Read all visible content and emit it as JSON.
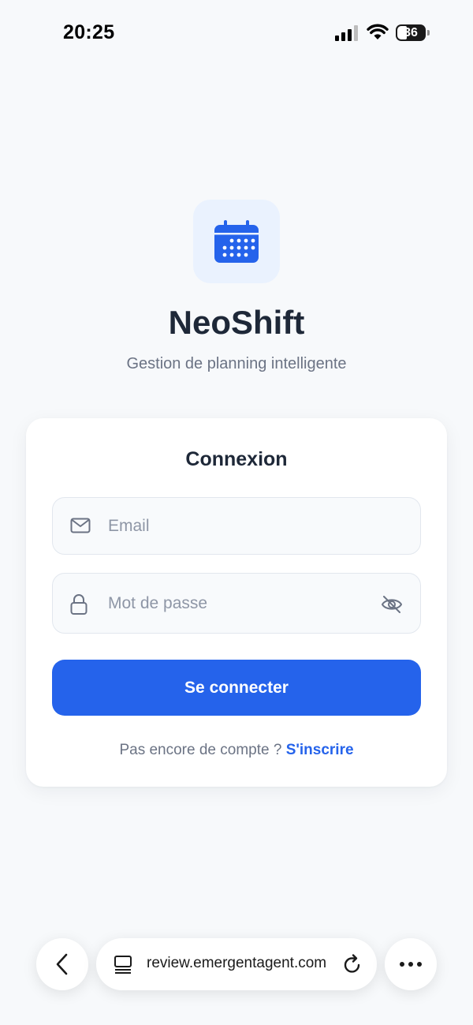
{
  "status_bar": {
    "time": "20:25",
    "battery": "36",
    "icons": [
      "signal-icon",
      "wifi-icon",
      "battery-icon"
    ]
  },
  "brand": {
    "logo_icon": "calendar-icon",
    "name": "NeoShift",
    "tagline": "Gestion de planning intelligente",
    "accent_color": "#2563eb"
  },
  "login": {
    "title": "Connexion",
    "email": {
      "value": "",
      "placeholder": "Email",
      "icon": "mail-icon"
    },
    "password": {
      "value": "",
      "placeholder": "Mot de passe",
      "icon": "lock-icon",
      "toggle_icon": "eye-off-icon"
    },
    "submit_label": "Se connecter",
    "signup_prompt": "Pas encore de compte ?",
    "signup_link": "S'inscrire"
  },
  "browser": {
    "url": "review.emergentagent.com",
    "icons": [
      "chevron-left-icon",
      "tabs-icon",
      "reload-icon",
      "more-icon"
    ]
  }
}
